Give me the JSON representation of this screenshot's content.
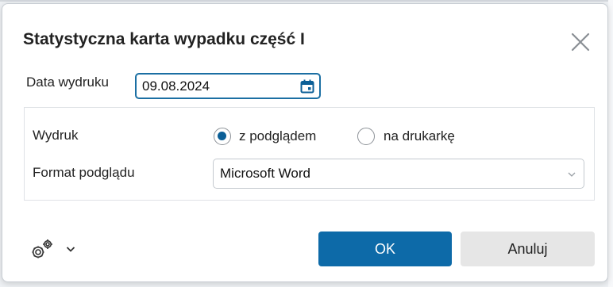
{
  "dialog": {
    "title": "Statystyczna karta wypadku część I",
    "close_icon": "close-icon"
  },
  "date": {
    "label": "Data wydruku",
    "value": "09.08.2024",
    "icon": "calendar-icon"
  },
  "print": {
    "label": "Wydruk",
    "options": [
      {
        "label": "z podglądem",
        "checked": true
      },
      {
        "label": "na drukarkę",
        "checked": false
      }
    ]
  },
  "preview_format": {
    "label": "Format podglądu",
    "selected": "Microsoft Word"
  },
  "footer": {
    "settings_icon": "gears-icon",
    "ok_label": "OK",
    "cancel_label": "Anuluj"
  },
  "colors": {
    "accent": "#0d6aa8",
    "focus_border": "#1b6fa3"
  }
}
